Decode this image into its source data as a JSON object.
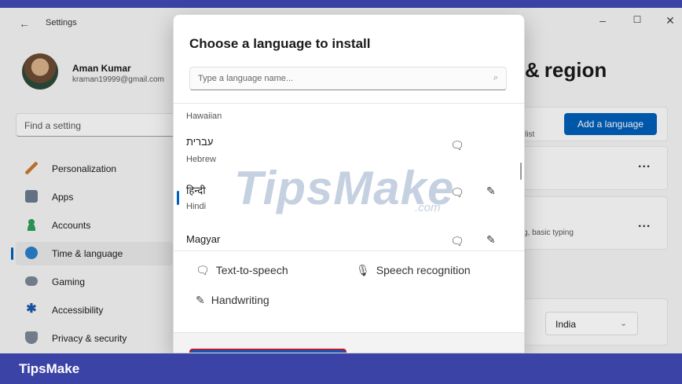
{
  "window": {
    "title": "Settings",
    "controls": [
      "–",
      "☐",
      "✕"
    ]
  },
  "profile": {
    "name": "Aman Kumar",
    "email": "kraman19999@gmail.com"
  },
  "search": {
    "placeholder": "Find a setting"
  },
  "sidebar": {
    "items": [
      {
        "label": "Personalization",
        "icon": "brush-icon",
        "color": "#c87a2c"
      },
      {
        "label": "Apps",
        "icon": "apps-icon",
        "color": "#6b7b8c"
      },
      {
        "label": "Accounts",
        "icon": "person-icon",
        "color": "#2e9e58"
      },
      {
        "label": "Time & language",
        "icon": "globe-clock-icon",
        "color": "#2a7fc9",
        "active": true
      },
      {
        "label": "Gaming",
        "icon": "gamepad-icon",
        "color": "#7a8795"
      },
      {
        "label": "Accessibility",
        "icon": "accessibility-icon",
        "color": "#1c5aa8"
      },
      {
        "label": "Privacy & security",
        "icon": "shield-icon",
        "color": "#7a8795"
      }
    ]
  },
  "main": {
    "heading_fragment": "region",
    "list_fragment": "list",
    "add_language_label": "Add a language",
    "more_label": "...",
    "typing_fragment": "g, basic typing",
    "region_value": "India"
  },
  "dialog": {
    "title": "Choose a language to install",
    "search_placeholder": "Type a language name...",
    "languages": [
      {
        "native": "Hawaiian",
        "english": "",
        "tts": false,
        "handwriting": false
      },
      {
        "native": "עברית",
        "english": "Hebrew",
        "tts": true,
        "handwriting": false
      },
      {
        "native": "हिन्दी",
        "english": "Hindi",
        "tts": true,
        "handwriting": true,
        "selected": true
      },
      {
        "native": "Magyar",
        "english": "",
        "tts": true,
        "handwriting": true
      }
    ],
    "legend": {
      "tts": "Text-to-speech",
      "speech": "Speech recognition",
      "handwriting": "Handwriting"
    }
  },
  "watermark": {
    "text": "TipsMake",
    "suffix": ".com"
  },
  "brand": {
    "text": "TipsMake"
  },
  "colors": {
    "accent": "#005fb8",
    "frame": "#3b44a6",
    "highlight_border": "#c8102e"
  }
}
